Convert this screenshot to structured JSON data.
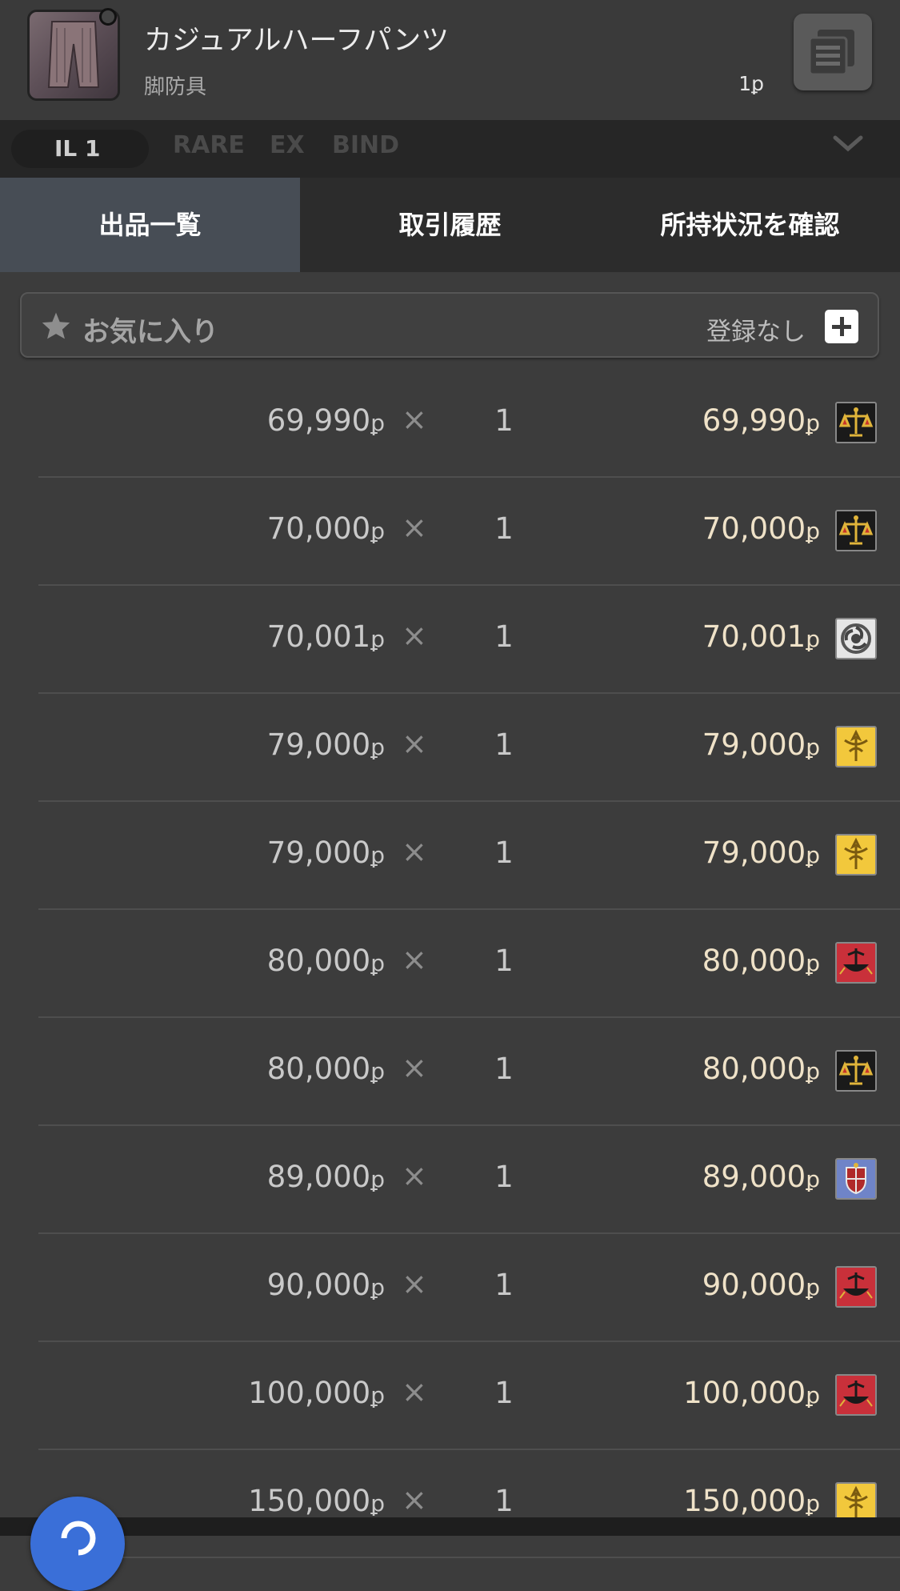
{
  "item": {
    "name": "カジュアルハーフパンツ",
    "category": "脚防具",
    "vendor_price": "1ꝑ"
  },
  "tags": {
    "il": "IL 1",
    "rare": "RARE",
    "ex": "EX",
    "bind": "BIND"
  },
  "tabs": [
    {
      "label": "出品一覧",
      "active": true
    },
    {
      "label": "取引履歴",
      "active": false
    },
    {
      "label": "所持状況を確認",
      "active": false
    }
  ],
  "favorites": {
    "label": "お気に入り",
    "status": "登録なし"
  },
  "gil_symbol": "ꝑ",
  "times_symbol": "×",
  "listings": [
    {
      "unit_price": "69,990",
      "quantity": "1",
      "total": "69,990",
      "crest": "scales-crest"
    },
    {
      "unit_price": "70,000",
      "quantity": "1",
      "total": "70,000",
      "crest": "scales-crest"
    },
    {
      "unit_price": "70,001",
      "quantity": "1",
      "total": "70,001",
      "crest": "tomoe-crest"
    },
    {
      "unit_price": "79,000",
      "quantity": "1",
      "total": "79,000",
      "crest": "gold-crest"
    },
    {
      "unit_price": "79,000",
      "quantity": "1",
      "total": "79,000",
      "crest": "gold-crest"
    },
    {
      "unit_price": "80,000",
      "quantity": "1",
      "total": "80,000",
      "crest": "ship-crest"
    },
    {
      "unit_price": "80,000",
      "quantity": "1",
      "total": "80,000",
      "crest": "scales-crest"
    },
    {
      "unit_price": "89,000",
      "quantity": "1",
      "total": "89,000",
      "crest": "shield-crest"
    },
    {
      "unit_price": "90,000",
      "quantity": "1",
      "total": "90,000",
      "crest": "ship-crest"
    },
    {
      "unit_price": "100,000",
      "quantity": "1",
      "total": "100,000",
      "crest": "ship-crest"
    },
    {
      "unit_price": "150,000",
      "quantity": "1",
      "total": "150,000",
      "crest": "gold-crest"
    }
  ],
  "colors": {
    "background": "#3c3c3c",
    "active_tab": "#474d55",
    "total_price": "#efe2c8",
    "fab": "#3a6fd8"
  }
}
